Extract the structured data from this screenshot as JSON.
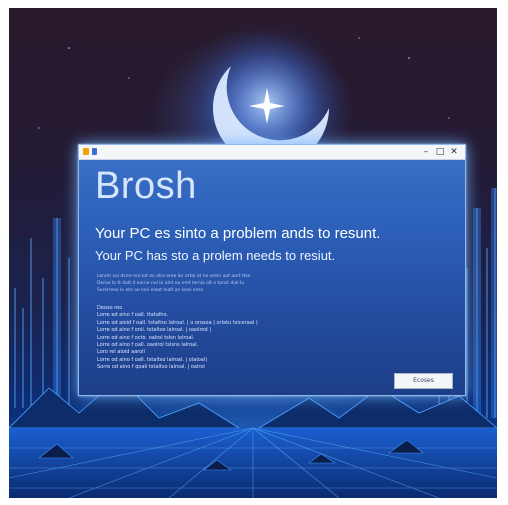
{
  "window": {
    "title": "",
    "minimize_glyph": "–",
    "maximize_glyph": "□",
    "close_glyph": "✕"
  },
  "dialog": {
    "heading": "Brosh",
    "line1": "Your PC es sinto a problem ands to resunt.",
    "line2": "Your PC has sto a prolem needs to resiut.",
    "paragraph": [
      "Lorom sui dsrre ero lot eo alra eroe lor ertal ot ne ereln aut aert tlee",
      "Deroe lo tt dalt d eorne nol lo alnt oa emt lernia olt e tonst dial lu",
      "Sorerreso ln ete oo lonl eleot lealt on larol erno"
    ],
    "section_label": "Deoso roo",
    "list_items": [
      "Lorre ed aino f oall. ttatalho.",
      "Lorre od aioid f oall. tstaltso lalroal. | o orosoa | orlatu tsiceraal )",
      "Lorre od aino f onii. tstaltso lalroal. | oaolrod )",
      "Lorre od aino f octo. oalrol tslsn lolroal.",
      "Lorre od aino f oall. oaolrol tslsns lalroal.",
      "Loro rel aioid aaroll",
      "Lorre od aino f oall. tstaltso lalroal. | olaloal)",
      "Sorre od aino f qoali tstaltso lalroal. | oalrol"
    ],
    "button_label": "Ecoses"
  },
  "colors": {
    "dialog_top": "#3d72c8",
    "dialog_bottom": "#1d3f88",
    "sky_top": "#2a1a2c",
    "glow": "#3c96ff"
  },
  "icons": [
    "crescent-moon-icon",
    "star-icon",
    "app-icon"
  ]
}
